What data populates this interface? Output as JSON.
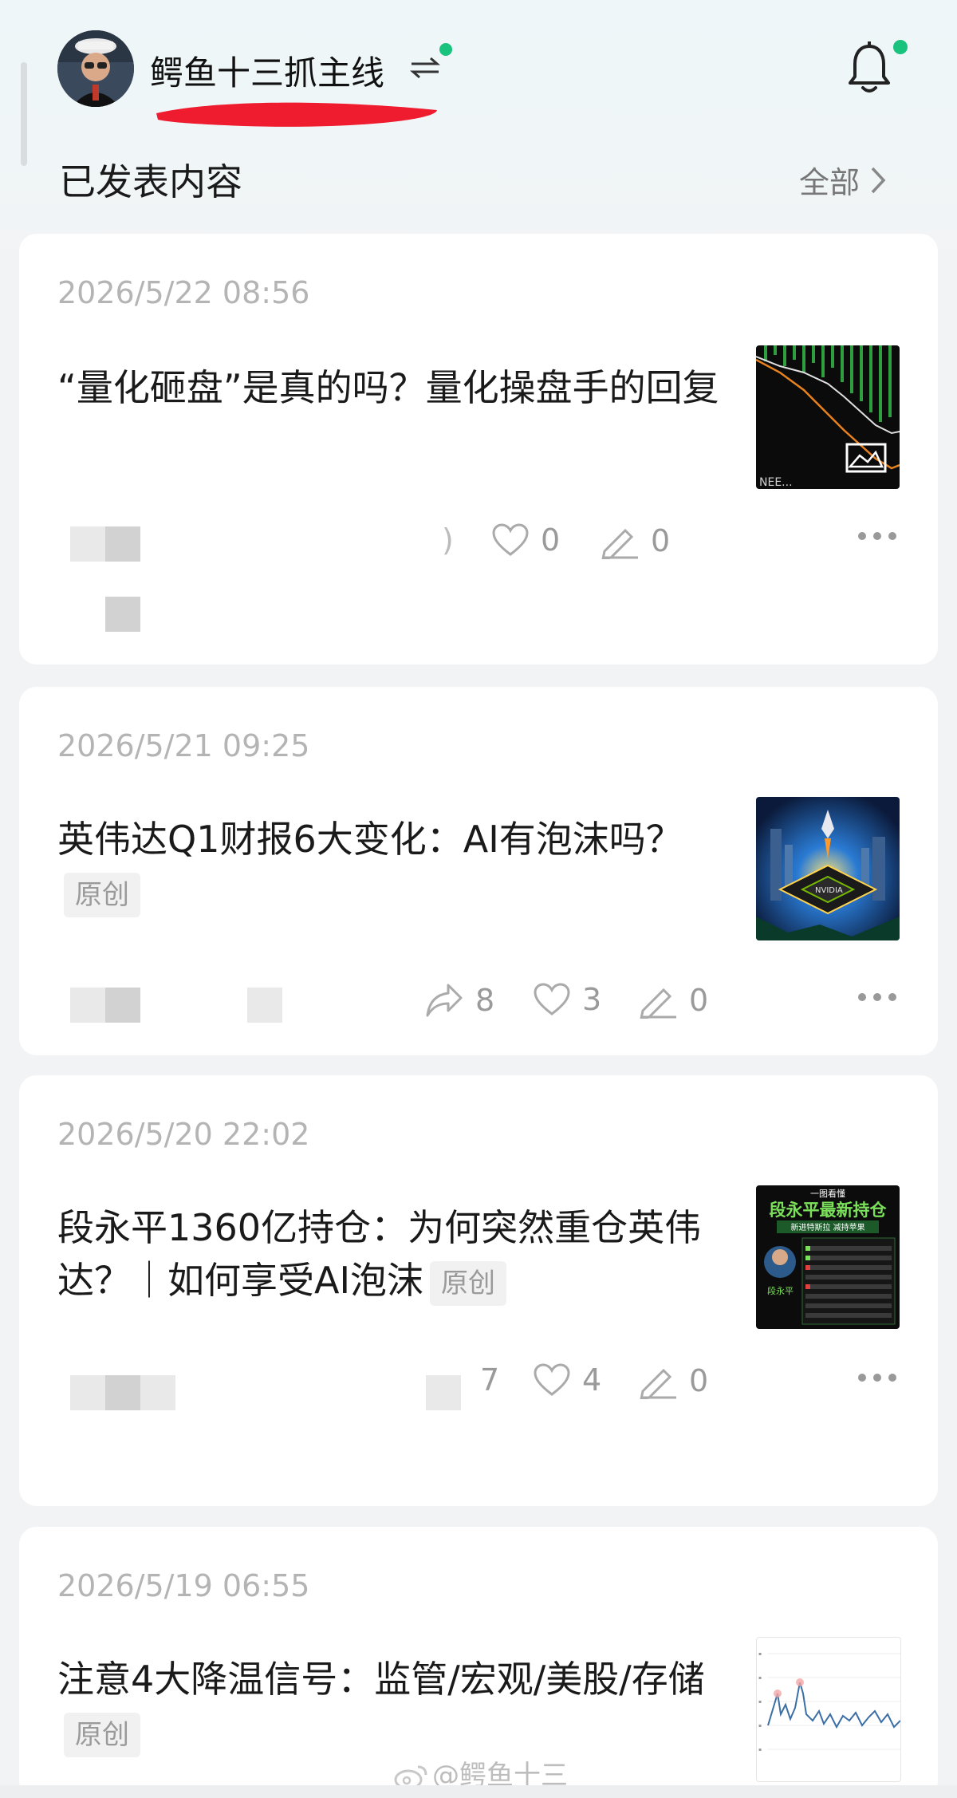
{
  "header": {
    "username": "鳄鱼十三抓主线",
    "switch_icon": "swap-arrows-icon",
    "notification_icon": "bell-icon",
    "accent": "#19c37d"
  },
  "section": {
    "title": "已发表内容",
    "view_all": "全部"
  },
  "posts": [
    {
      "date": "2026/5/22 08:56",
      "title": "“量化砸盘”是真的吗？量化操盘手的回复",
      "tag": "",
      "shares": "",
      "likes": "0",
      "comments": "0",
      "thumb_caption": "NEE..."
    },
    {
      "date": "2026/5/21 09:25",
      "title": "英伟达Q1财报6大变化：AI有泡沫吗？",
      "tag": "原创",
      "shares": "8",
      "likes": "3",
      "comments": "0",
      "thumb_caption": "NVIDIA"
    },
    {
      "date": "2026/5/20 22:02",
      "title": "段永平1360亿持仓：为何突然重仓英伟达？｜如何享受AI泡沫",
      "tag": "原创",
      "shares": "7",
      "likes": "4",
      "comments": "0",
      "thumb_title": "段永平最新持仓",
      "thumb_top": "一图看懂",
      "thumb_sub": "新进特斯拉  减持苹果",
      "thumb_name": "段永平"
    },
    {
      "date": "2026/5/19 06:55",
      "title": "注意4大降温信号：监管/宏观/美股/存储",
      "tag": "原创"
    }
  ],
  "watermark": "@鳄鱼十三"
}
